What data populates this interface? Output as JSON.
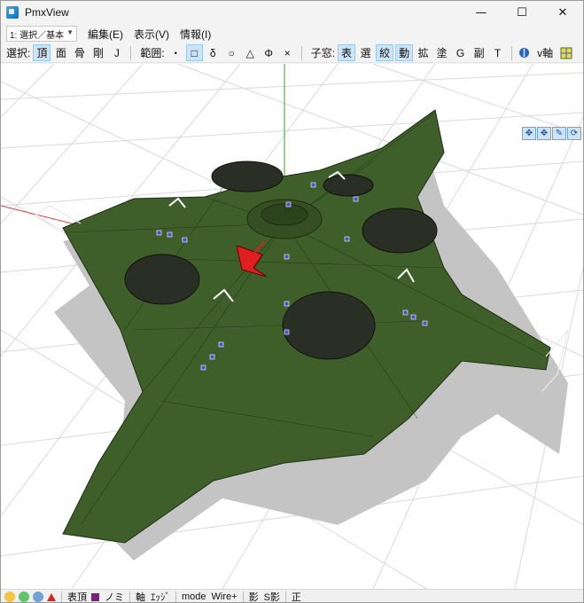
{
  "window": {
    "title": "PmxView"
  },
  "controls": {
    "minimize": "—",
    "maximize": "☐",
    "close": "✕"
  },
  "menubar": {
    "mode_select": "1: 選択／基本",
    "items": [
      "編集(E)",
      "表示(V)",
      "情報(I)"
    ]
  },
  "toolbar": {
    "select_label": "選択:",
    "select_buttons": [
      "頂",
      "面",
      "骨",
      "剛",
      "J"
    ],
    "range_label": "範囲:",
    "range_buttons": [
      "・",
      "□",
      "δ",
      "○",
      "△",
      "Φ",
      "×"
    ],
    "subwin_label": "子窓:",
    "subwin_buttons": [
      "表",
      "選",
      "絞",
      "動",
      "拡",
      "塗",
      "G",
      "副",
      "T"
    ],
    "axis_label": "v軸"
  },
  "statusbar": {
    "items": [
      "表頂",
      "ノミ",
      "軸",
      "ｴｯｼﾞ",
      "mode",
      "Wire+",
      "影",
      "S影",
      "正"
    ]
  },
  "colors": {
    "hull": "#3f5f2a",
    "accent_red": "#e02020",
    "vertex": "#4a52d8",
    "grid": "#d9d9d9",
    "shadow": "#c4c4c4"
  },
  "icons": [
    "search-icon",
    "axis-icon"
  ]
}
